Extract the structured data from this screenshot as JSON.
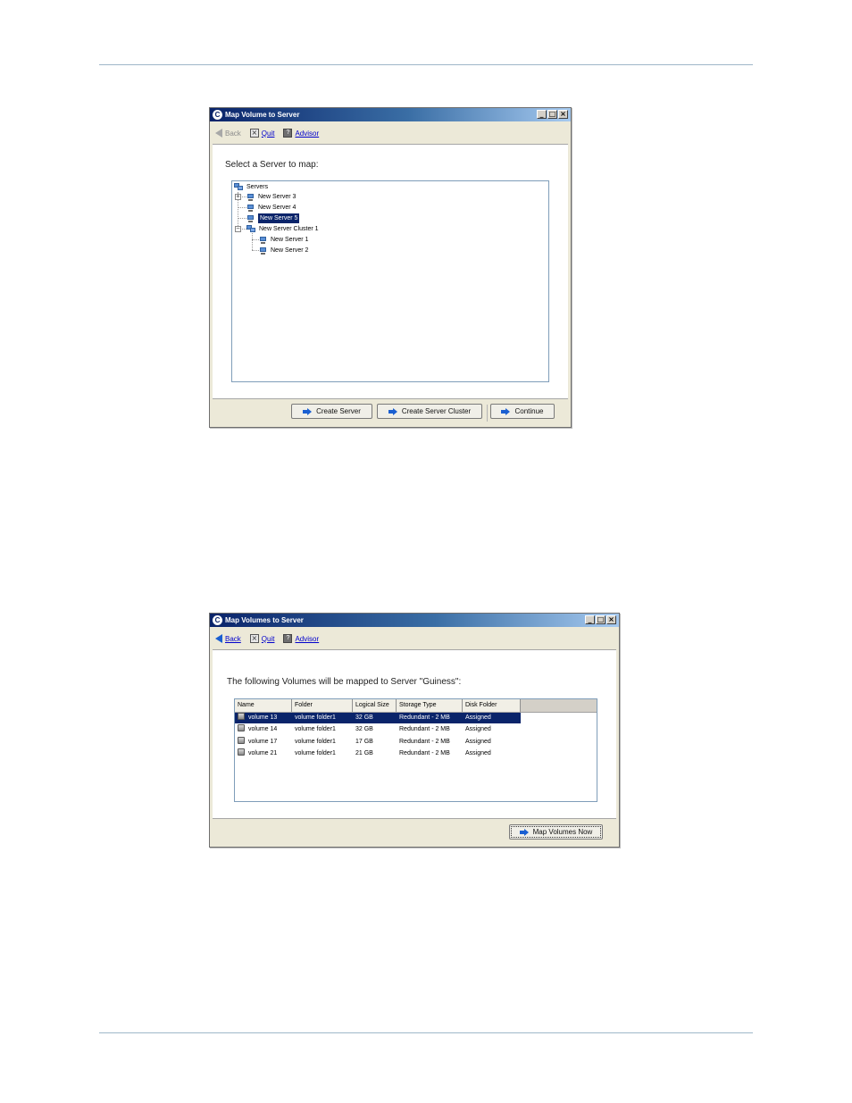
{
  "window1": {
    "title": "Map Volume to Server",
    "window_controls": [
      "_",
      "□",
      "×"
    ],
    "toolbar": {
      "back_label": "Back",
      "quit_label": "Quit",
      "advisor_label": "Advisor"
    },
    "prompt": "Select a Server to map:",
    "tree": {
      "root": "Servers",
      "items": [
        {
          "label": "New Server 3",
          "expander": "+"
        },
        {
          "label": "New Server 4"
        },
        {
          "label": "New Server 5",
          "selected": true
        },
        {
          "label": "New Server Cluster 1",
          "expander": "−"
        },
        {
          "label": "New Server 1"
        },
        {
          "label": "New Server 2"
        }
      ]
    },
    "buttons": {
      "create_server": "Create Server",
      "create_server_cluster": "Create Server Cluster",
      "continue": "Continue"
    }
  },
  "window2": {
    "title": "Map Volumes to Server",
    "window_controls": [
      "_",
      "□",
      "×"
    ],
    "toolbar": {
      "back_label": "Back",
      "quit_label": "Quit",
      "advisor_label": "Advisor"
    },
    "prompt": "The following Volumes will be mapped to Server \"Guiness\":",
    "table": {
      "columns": [
        "Name",
        "Folder",
        "Logical Size",
        "Storage Type",
        "Disk Folder"
      ],
      "rows": [
        [
          "volume 13",
          "volume folder1",
          "32 GB",
          "Redundant - 2 MB",
          "Assigned"
        ],
        [
          "volume 14",
          "volume folder1",
          "32 GB",
          "Redundant - 2 MB",
          "Assigned"
        ],
        [
          "volume 17",
          "volume folder1",
          "17 GB",
          "Redundant - 2 MB",
          "Assigned"
        ],
        [
          "volume 21",
          "volume folder1",
          "21 GB",
          "Redundant - 2 MB",
          "Assigned"
        ]
      ]
    },
    "buttons": {
      "map_volumes_now": "Map Volumes Now"
    }
  },
  "colors": {
    "title_bar": "#0a246a",
    "selection": "#0a246a",
    "link": "#0000cc",
    "page_rule": "#9fb7c9"
  }
}
